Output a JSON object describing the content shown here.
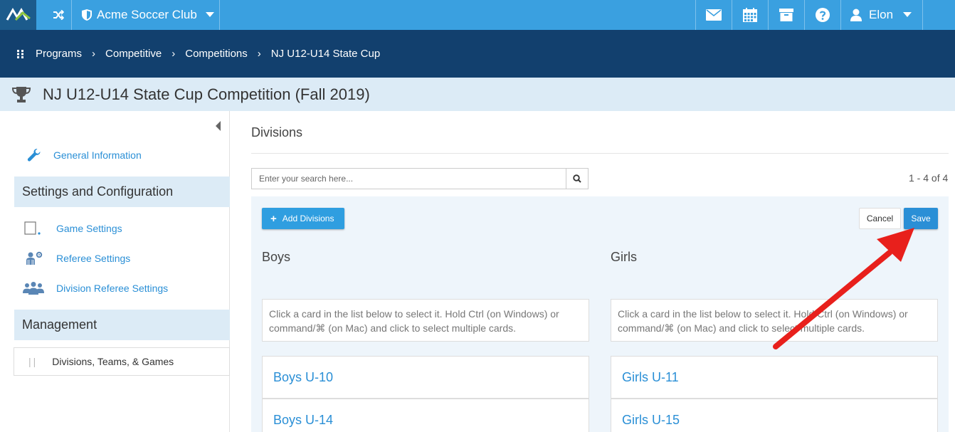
{
  "topbar": {
    "club_name": "Acme Soccer Club",
    "user_name": "Elon",
    "icons": [
      "shuffle-icon",
      "shield-icon",
      "mail-icon",
      "calendar-icon",
      "archive-icon",
      "help-icon",
      "user-icon"
    ]
  },
  "breadcrumb": [
    "Programs",
    "Competitive",
    "Competitions",
    "NJ U12-U14 State Cup"
  ],
  "page_title": "NJ U12-U14 State Cup Competition (Fall 2019)",
  "sidebar": {
    "general": "General Information",
    "settings_heading": "Settings and Configuration",
    "game_settings": "Game Settings",
    "referee_settings": "Referee Settings",
    "division_referee_settings": "Division Referee Settings",
    "management_heading": "Management",
    "divisions_teams_games": "Divisions, Teams, & Games"
  },
  "main": {
    "section_title": "Divisions",
    "search_placeholder": "Enter your search here...",
    "count": "1 - 4 of 4",
    "add_label": "Add Divisions",
    "cancel_label": "Cancel",
    "save_label": "Save",
    "hint": "Click a card in the list below to select it. Hold Ctrl (on Windows) or command/⌘ (on Mac) and click to select multiple cards.",
    "boys": {
      "title": "Boys",
      "cards": [
        "Boys U-10",
        "Boys U-14"
      ]
    },
    "girls": {
      "title": "Girls",
      "cards": [
        "Girls U-11",
        "Girls U-15"
      ]
    }
  },
  "colors": {
    "topbar": "#3aa0e0",
    "breadcrumb_bar": "#12406e",
    "accent": "#2a8fd6",
    "annotation_arrow": "#e8201c"
  }
}
